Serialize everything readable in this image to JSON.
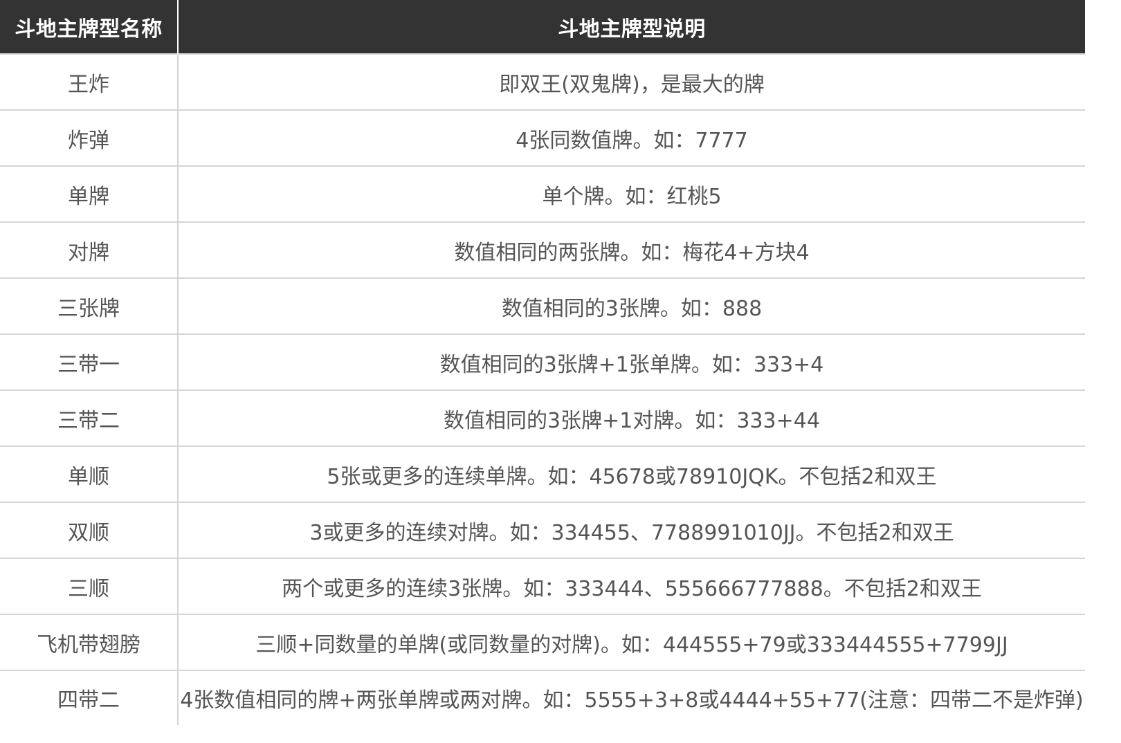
{
  "table": {
    "headers": [
      "斗地主牌型名称",
      "斗地主牌型说明"
    ],
    "rows": [
      {
        "name": "王炸",
        "desc": "即双王(双鬼牌)，是最大的牌"
      },
      {
        "name": "炸弹",
        "desc": "4张同数值牌。如：7777"
      },
      {
        "name": "单牌",
        "desc": "单个牌。如：红桃5"
      },
      {
        "name": "对牌",
        "desc": "数值相同的两张牌。如：梅花4+方块4"
      },
      {
        "name": "三张牌",
        "desc": "数值相同的3张牌。如：888"
      },
      {
        "name": "三带一",
        "desc": "数值相同的3张牌+1张单牌。如：333+4"
      },
      {
        "name": "三带二",
        "desc": "数值相同的3张牌+1对牌。如：333+44"
      },
      {
        "name": "单顺",
        "desc": "5张或更多的连续单牌。如：45678或78910JQK。不包括2和双王"
      },
      {
        "name": "双顺",
        "desc": "3或更多的连续对牌。如：334455、7788991010JJ。不包括2和双王"
      },
      {
        "name": "三顺",
        "desc": "两个或更多的连续3张牌。如：333444、555666777888。不包括2和双王"
      },
      {
        "name": "飞机带翅膀",
        "desc": "三顺+同数量的单牌(或同数量的对牌)。如：444555+79或333444555+7799JJ"
      },
      {
        "name": "四带二",
        "desc": "4张数值相同的牌+两张单牌或两对牌。如：5555+3+8或4444+55+77(注意：四带二不是炸弹)"
      }
    ]
  },
  "colors": {
    "header_bg": "#333333",
    "header_text": "#ffffff",
    "cell_text": "#555555",
    "border": "#d5d5d5"
  }
}
